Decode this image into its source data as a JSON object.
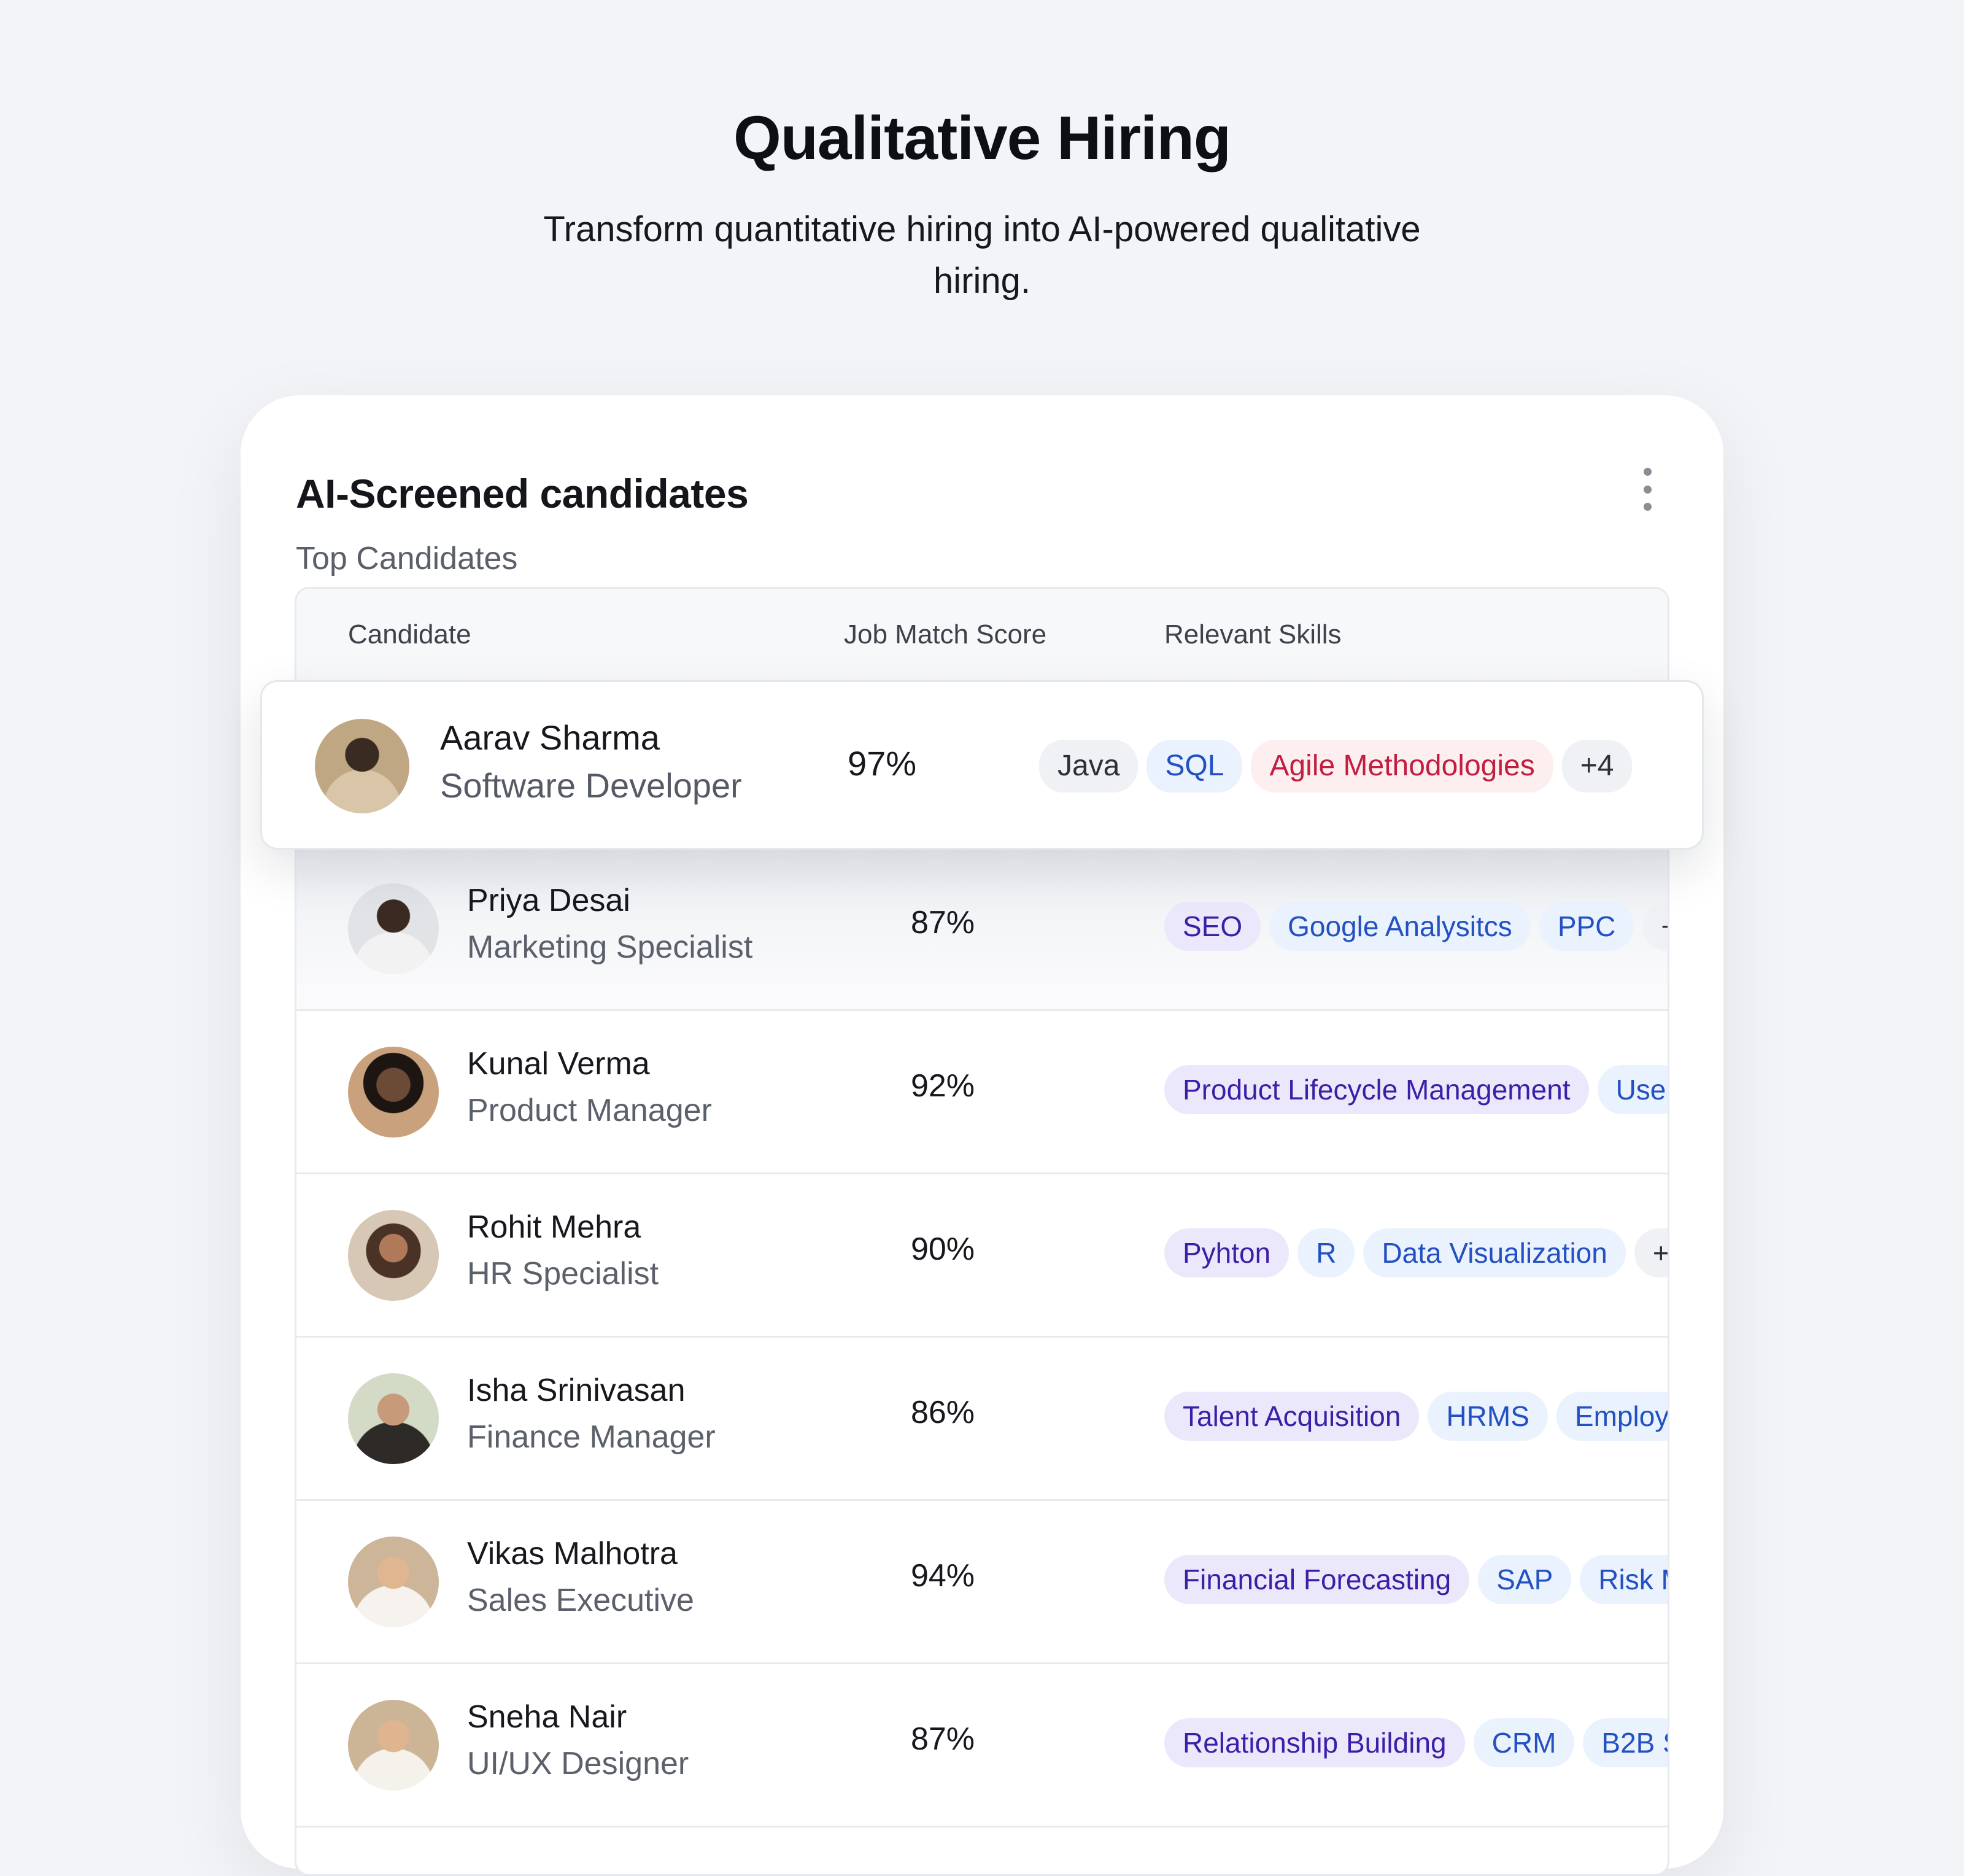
{
  "hero": {
    "title": "Qualitative Hiring",
    "subtitle": "Transform quantitative hiring into AI-powered qualitative hiring."
  },
  "card": {
    "title": "AI-Screened candidates",
    "subtitle": "Top Candidates",
    "menu_icon": "kebab-menu-icon"
  },
  "table": {
    "headers": {
      "candidate": "Candidate",
      "score": "Job Match Score",
      "skills": "Relevant Skills"
    },
    "highlighted": {
      "name": "Aarav Sharma",
      "role": "Software Developer",
      "score": "97%",
      "skills": [
        "Java",
        "SQL",
        "Agile Methodologies",
        "+4"
      ]
    },
    "rows": [
      {
        "name": "Priya Desai",
        "role": "Marketing Specialist",
        "score": "87%",
        "skills": [
          "SEO",
          "Google Analysitcs",
          "PPC",
          "+"
        ]
      },
      {
        "name": "Kunal Verma",
        "role": "Product Manager",
        "score": "92%",
        "skills": [
          "Product Lifecycle Management",
          "Use"
        ]
      },
      {
        "name": "Rohit Mehra",
        "role": "HR Specialist",
        "score": "90%",
        "skills": [
          "Pyhton",
          "R",
          "Data Visualization",
          "+"
        ]
      },
      {
        "name": "Isha Srinivasan",
        "role": "Finance Manager",
        "score": "86%",
        "skills": [
          "Talent Acquisition",
          "HRMS",
          "Employ"
        ]
      },
      {
        "name": "Vikas Malhotra",
        "role": "Sales Executive",
        "score": "94%",
        "skills": [
          "Financial Forecasting",
          "SAP",
          "Risk M"
        ]
      },
      {
        "name": "Sneha Nair",
        "role": "UI/UX Designer",
        "score": "87%",
        "skills": [
          "Relationship Building",
          "CRM",
          "B2B S"
        ]
      }
    ]
  },
  "colors": {
    "background": "#f3f4f7",
    "chip_purple": "#ece8fb",
    "chip_blue": "#eaf2fd",
    "chip_red": "#fdeef0",
    "chip_gray": "#f0f1f4"
  }
}
